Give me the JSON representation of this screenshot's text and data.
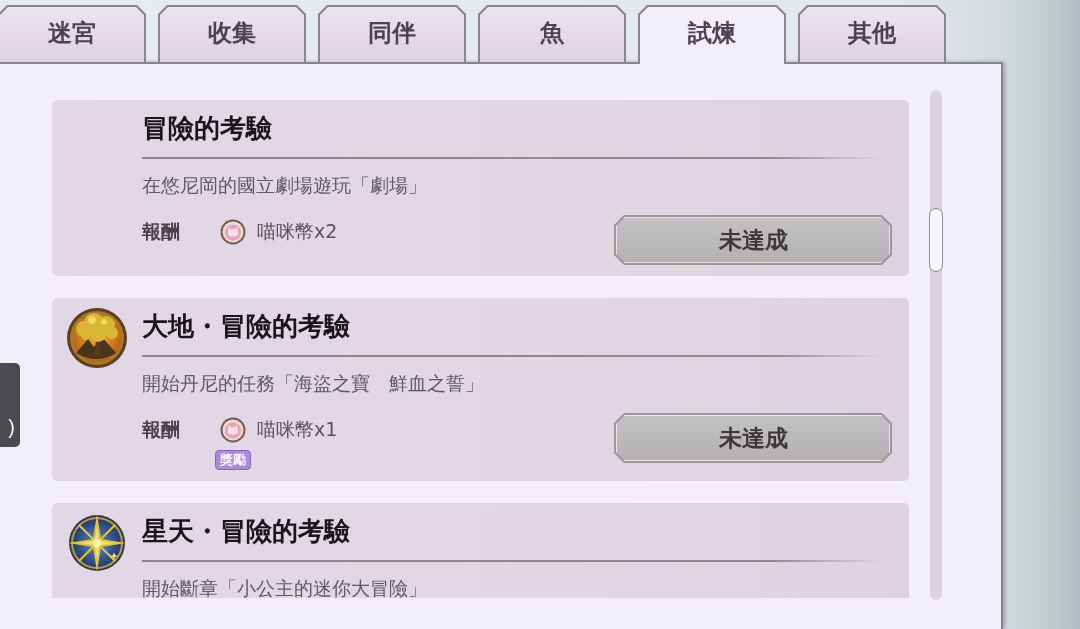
{
  "tabs": [
    {
      "label": "迷宮",
      "selected": false
    },
    {
      "label": "收集",
      "selected": false
    },
    {
      "label": "同伴",
      "selected": false
    },
    {
      "label": "魚",
      "selected": false
    },
    {
      "label": "試煉",
      "selected": true
    },
    {
      "label": "其他",
      "selected": false
    }
  ],
  "side_tab": {
    "label": ")"
  },
  "trials": [
    {
      "kind": "plain",
      "title": "冒險的考驗",
      "description": "在悠尼岡的國立劇場遊玩「劇場」",
      "reward_label": "報酬",
      "reward": "喵咪幣x2",
      "status": "未達成"
    },
    {
      "kind": "tree",
      "title": "大地・冒險的考驗",
      "description": "開始丹尼的任務「海盜之寶　鮮血之誓」",
      "reward_label": "報酬",
      "reward": "喵咪幣x1",
      "badge": "獎勵",
      "status": "未達成"
    },
    {
      "kind": "star",
      "title": "星天・冒險的考驗",
      "description": "開始斷章「小公主的迷你大冒險」"
    }
  ]
}
